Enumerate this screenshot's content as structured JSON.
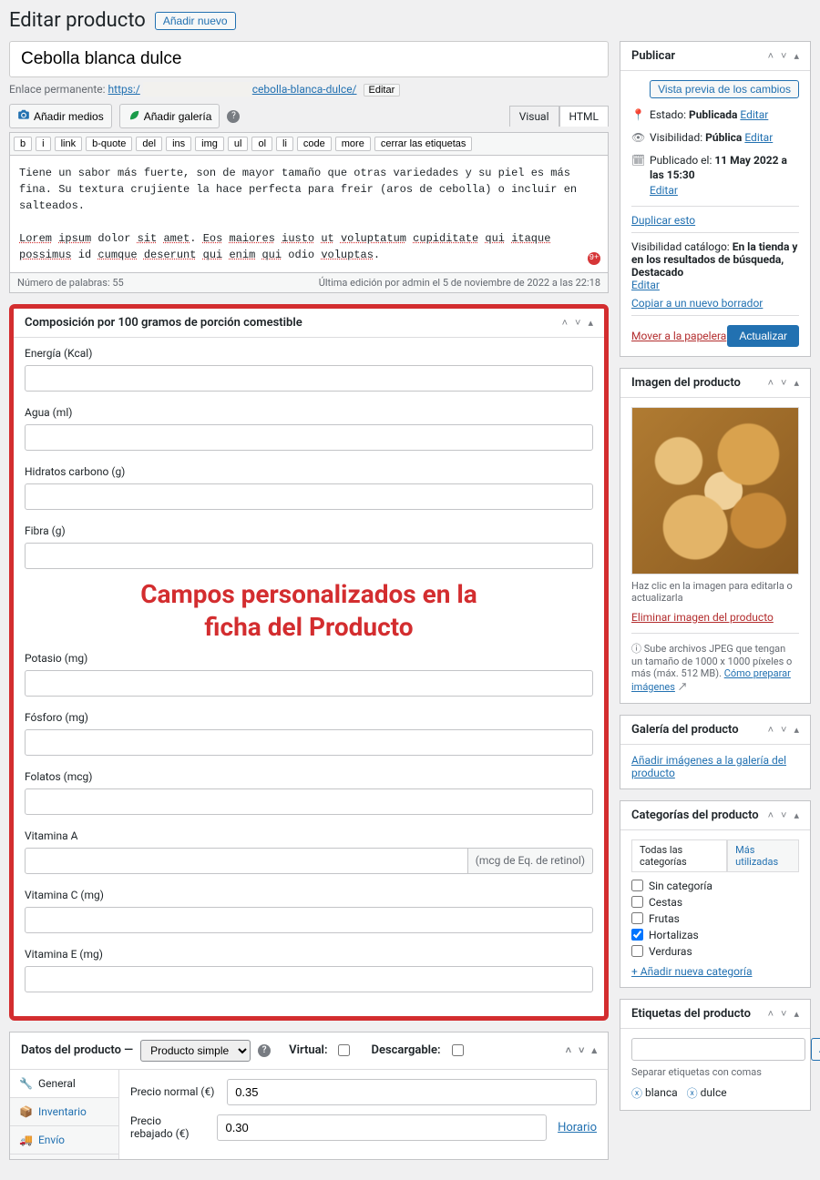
{
  "page": {
    "title": "Editar producto",
    "add_new": "Añadir nuevo"
  },
  "post": {
    "title": "Cebolla blanca dulce",
    "permalink_label": "Enlace permanente:",
    "permalink_base": "https:/",
    "permalink_slug": "cebolla-blanca-dulce/",
    "permalink_edit": "Editar"
  },
  "media": {
    "add_media": "Añadir medios",
    "add_gallery": "Añadir galería"
  },
  "editor": {
    "visual": "Visual",
    "html": "HTML",
    "quicktags": [
      "b",
      "i",
      "link",
      "b-quote",
      "del",
      "ins",
      "img",
      "ul",
      "ol",
      "li",
      "code",
      "more",
      "cerrar las etiquetas"
    ],
    "content_lines": [
      "Tiene un sabor más fuerte, son de mayor tamaño que otras variedades y su piel es más fina. Su textura crujiente la hace perfecta para freir (aros de cebolla) o incluir en salteados.",
      "Lorem ipsum dolor sit amet. Eos maiores iusto ut voluptatum cupiditate qui itaque possimus id cumque deserunt qui enim qui odio voluptas."
    ],
    "word_count_label": "Número de palabras: 55",
    "last_edit": "Última edición por admin el 5 de noviembre de 2022 a las 22:18",
    "badge": "9+"
  },
  "composition": {
    "title": "Composición por 100 gramos de porción comestible",
    "overlay1": "Campos personalizados en la",
    "overlay2": "ficha del Producto",
    "fields": [
      {
        "label": "Energía (Kcal)"
      },
      {
        "label": "Agua (ml)"
      },
      {
        "label": "Hidratos carbono (g)"
      },
      {
        "label": "Fibra (g)"
      },
      {
        "label": "Potasio (mg)"
      },
      {
        "label": "Fósforo (mg)"
      },
      {
        "label": "Folatos (mcg)"
      },
      {
        "label": "Vitamina A",
        "suffix": "(mcg de Eq. de retinol)"
      },
      {
        "label": "Vitamina C (mg)"
      },
      {
        "label": "Vitamina E (mg)"
      }
    ]
  },
  "product_data": {
    "title": "Datos del producto —",
    "type": "Producto simple",
    "virtual": "Virtual:",
    "downloadable": "Descargable:",
    "tabs": [
      "General",
      "Inventario",
      "Envío"
    ],
    "price_regular_label": "Precio normal (€)",
    "price_regular": "0.35",
    "price_sale_label": "Precio rebajado (€)",
    "price_sale": "0.30",
    "schedule": "Horario"
  },
  "publish": {
    "title": "Publicar",
    "preview": "Vista previa de los cambios",
    "status_label": "Estado:",
    "status_value": "Publicada",
    "edit": "Editar",
    "visibility_label": "Visibilidad:",
    "visibility_value": "Pública",
    "published_label": "Publicado el:",
    "published_value": "11 May 2022 a las 15:30",
    "duplicate": "Duplicar esto",
    "catalog_label": "Visibilidad catálogo:",
    "catalog_value": "En la tienda y en los resultados de búsqueda, Destacado",
    "copy_draft": "Copiar a un nuevo borrador",
    "trash": "Mover a la papelera",
    "update": "Actualizar"
  },
  "image_box": {
    "title": "Imagen del producto",
    "hint": "Haz clic en la imagen para editarla o actualizarla",
    "remove": "Eliminar imagen del producto",
    "info1": "Sube archivos JPEG que tengan un tamaño de 1000 x 1000 píxeles o más (máx. 512 MB).",
    "info_link": "Cómo preparar imágenes"
  },
  "gallery": {
    "title": "Galería del producto",
    "add": "Añadir imágenes a la galería del producto"
  },
  "categories": {
    "title": "Categorías del producto",
    "tab_all": "Todas las categorías",
    "tab_most": "Más utilizadas",
    "items": [
      {
        "label": "Sin categoría",
        "checked": false
      },
      {
        "label": "Cestas",
        "checked": false
      },
      {
        "label": "Frutas",
        "checked": false
      },
      {
        "label": "Hortalizas",
        "checked": true
      },
      {
        "label": "Verduras",
        "checked": false
      }
    ],
    "add_new": "+ Añadir nueva categoría"
  },
  "tags": {
    "title": "Etiquetas del producto",
    "add": "Añadir",
    "hint": "Separar etiquetas con comas",
    "items": [
      "blanca",
      "dulce"
    ]
  }
}
